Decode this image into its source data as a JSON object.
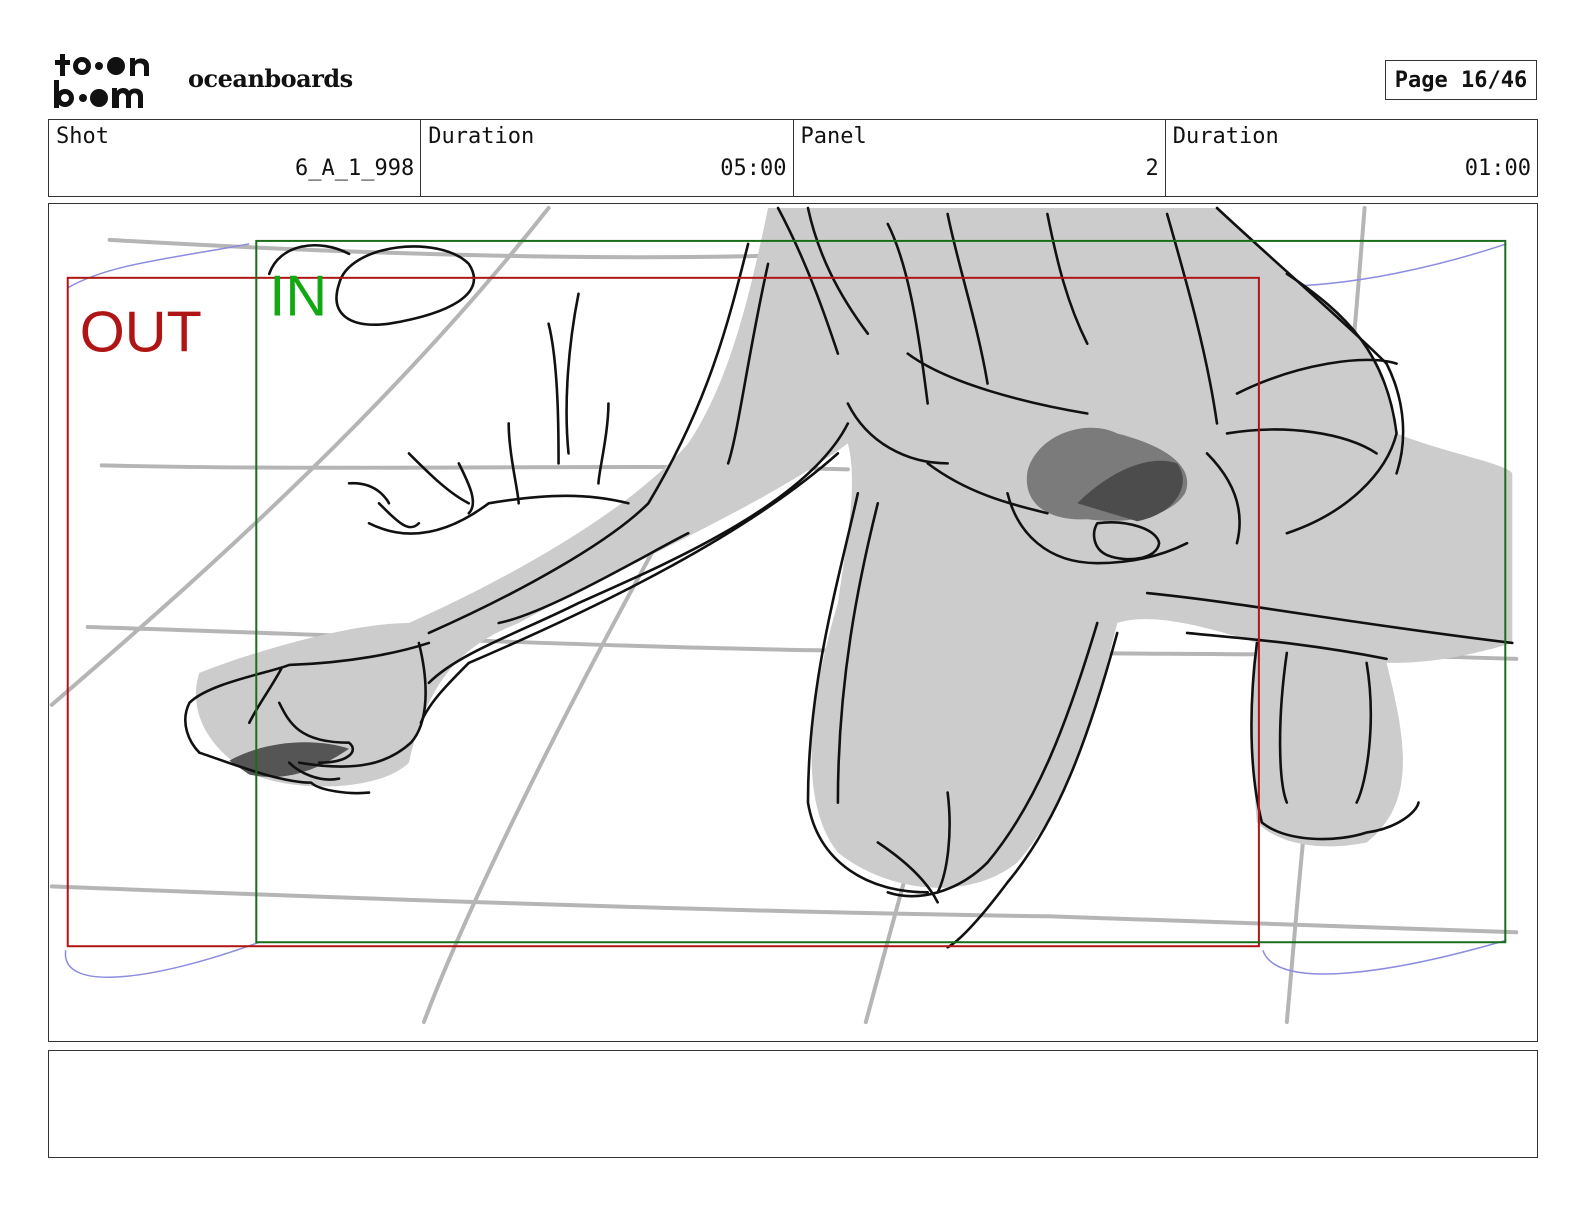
{
  "header": {
    "logo_text": "toon boom",
    "project_name": "oceanboards",
    "page_label": "Page 16/46"
  },
  "info": [
    {
      "label": "Shot",
      "value": "6_A_1_998"
    },
    {
      "label": "Duration",
      "value": "05:00"
    },
    {
      "label": "Panel",
      "value": "2"
    },
    {
      "label": "Duration",
      "value": "01:00"
    }
  ],
  "panel": {
    "out_label": "OUT",
    "in_label": "IN",
    "colors": {
      "out_frame": "#b01515",
      "in_frame": "#1a6e1a",
      "in_text": "#11a811",
      "fill_gray": "#cccccc",
      "guide_gray": "#b0b0b0",
      "camera_path": "#8c8ce0"
    }
  },
  "notes": {
    "text": ""
  }
}
